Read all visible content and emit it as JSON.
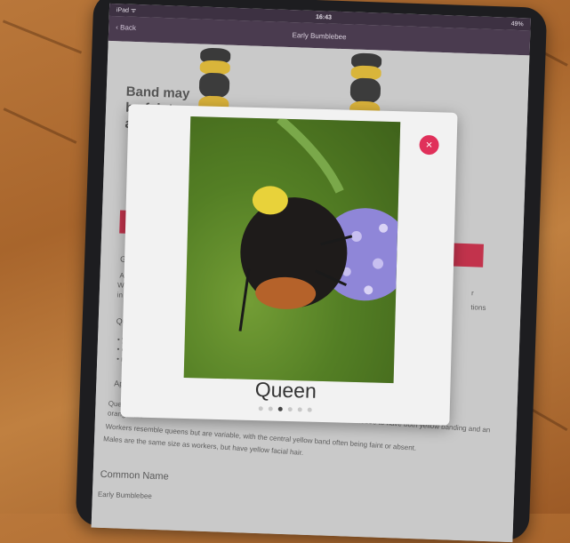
{
  "statusbar": {
    "carrier": "iPad ᯤ",
    "time": "16:43",
    "battery": "49%"
  },
  "nav": {
    "back_label": "‹ Back",
    "title": "Early Bumblebee"
  },
  "background": {
    "band_text": "Band may be faint or a",
    "general_heading": "Gene",
    "general_text_1": "A sma",
    "general_text_2": "Wester",
    "general_text_3": "in a yo",
    "quick_heading": "Quick",
    "bullets": [
      "ye",
      "or",
      "m"
    ],
    "right_fragment_1": "r",
    "right_fragment_2": "tions",
    "appearance_heading": "Appe",
    "appearance_text_1": "Queens are smaller than those of other species and are the only common bumblebee to have both yellow banding and an orange tail.",
    "appearance_text_2": "Workers resemble queens but are variable, with the central yellow band often being faint or absent.",
    "appearance_text_3": "Males are the same size as workers, but have yellow facial hair.",
    "common_name_heading": "Common Name",
    "common_name_value": "Early Bumblebee"
  },
  "modal": {
    "caption": "Queen",
    "close_label": "×",
    "dots_total": 6,
    "active_dot": 2
  },
  "colors": {
    "accent": "#e0305a",
    "navbar": "#4a3b4f",
    "red_bar": "#c2334c"
  }
}
